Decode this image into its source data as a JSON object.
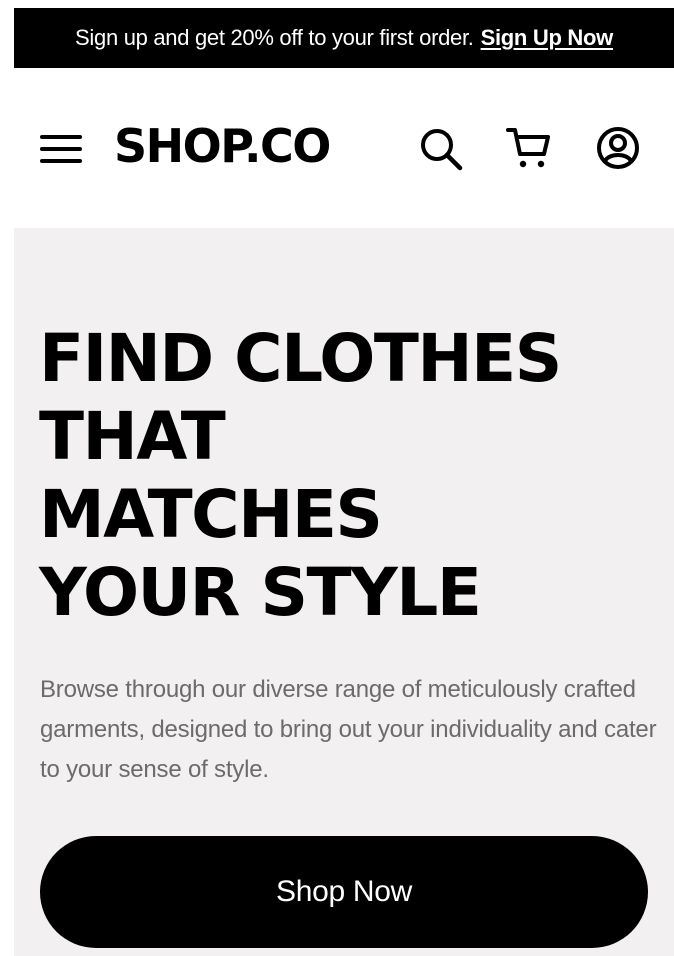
{
  "promo": {
    "text": "Sign up and get 20% off to your first order.",
    "link_label": "Sign Up Now"
  },
  "header": {
    "logo": "SHOP.CO",
    "icons": [
      "menu-icon",
      "search-icon",
      "cart-icon",
      "account-icon"
    ]
  },
  "hero": {
    "title_lines": [
      "FIND CLOTHES",
      "THAT",
      "MATCHES",
      "YOUR STYLE"
    ],
    "description": "Browse through our diverse range of meticulously crafted garments, designed to bring out your individuality and cater to your sense of style.",
    "cta_label": "Shop Now"
  },
  "colors": {
    "promo_background": "#000000",
    "hero_background": "#f2f0f1",
    "text_primary": "#000000",
    "text_muted": "#6b6b6b",
    "button_background": "#000000",
    "button_text": "#ffffff"
  }
}
